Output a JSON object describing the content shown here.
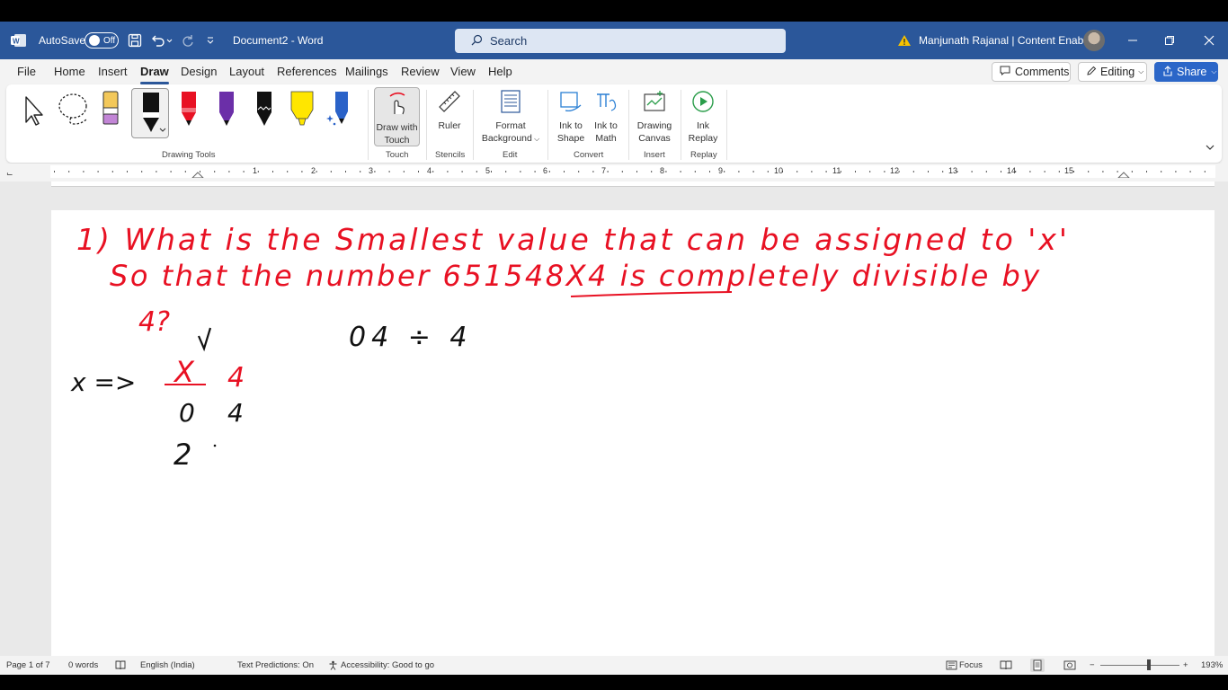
{
  "titlebar": {
    "autosave_label": "AutoSave",
    "autosave_state": "Off",
    "doc_title": "Document2  -  Word",
    "search_placeholder": "Search",
    "user_name": "Manjunath Rajanal | Content Enablers"
  },
  "tabs": [
    "File",
    "Home",
    "Insert",
    "Draw",
    "Design",
    "Layout",
    "References",
    "Mailings",
    "Review",
    "View",
    "Help"
  ],
  "active_tab": "Draw",
  "top_buttons": {
    "comments": "Comments",
    "editing": "Editing",
    "share": "Share"
  },
  "ribbon": {
    "groups": {
      "drawing_tools": "Drawing Tools",
      "touch": "Touch",
      "stencils": "Stencils",
      "edit": "Edit",
      "convert": "Convert",
      "insert": "Insert",
      "replay": "Replay"
    },
    "draw_with_touch": [
      "Draw with",
      "Touch"
    ],
    "ruler": "Ruler",
    "format_background": [
      "Format",
      "Background"
    ],
    "ink_to_shape": [
      "Ink to",
      "Shape"
    ],
    "ink_to_math": [
      "Ink to",
      "Math"
    ],
    "drawing_canvas": [
      "Drawing",
      "Canvas"
    ],
    "ink_replay": [
      "Ink",
      "Replay"
    ],
    "pens": [
      {
        "name": "eraser",
        "color": "#f3c85a"
      },
      {
        "name": "pen-black",
        "color": "#000000"
      },
      {
        "name": "pen-red",
        "color": "#e81123"
      },
      {
        "name": "pen-purple",
        "color": "#6b2fa8"
      },
      {
        "name": "pen-black-galaxy",
        "color": "#111111"
      },
      {
        "name": "highlighter-yellow",
        "color": "#ffe600"
      },
      {
        "name": "pen-blue-galaxy",
        "color": "#2a62c8"
      }
    ]
  },
  "ruler_numbers": [
    "1",
    "2",
    "3",
    "4",
    "5",
    "6",
    "7",
    "8",
    "9",
    "10",
    "11",
    "12",
    "13",
    "14",
    "15"
  ],
  "document": {
    "ink_line1": "1) What is the Smallest value that can be assigned to 'x'",
    "ink_line2": "So that the number  651548X4  is completely divisible by",
    "ink_line3": "4?",
    "ink_work": "04 ÷ 4",
    "ink_x_label": "x =>",
    "ink_X": "X",
    "ink_4a": "4",
    "ink_0": "0",
    "ink_4b": "4",
    "ink_2": "2"
  },
  "statusbar": {
    "page": "Page 1 of 7",
    "words": "0 words",
    "language": "English (India)",
    "text_predictions": "Text Predictions: On",
    "accessibility": "Accessibility: Good to go",
    "focus": "Focus",
    "zoom": "193%"
  }
}
